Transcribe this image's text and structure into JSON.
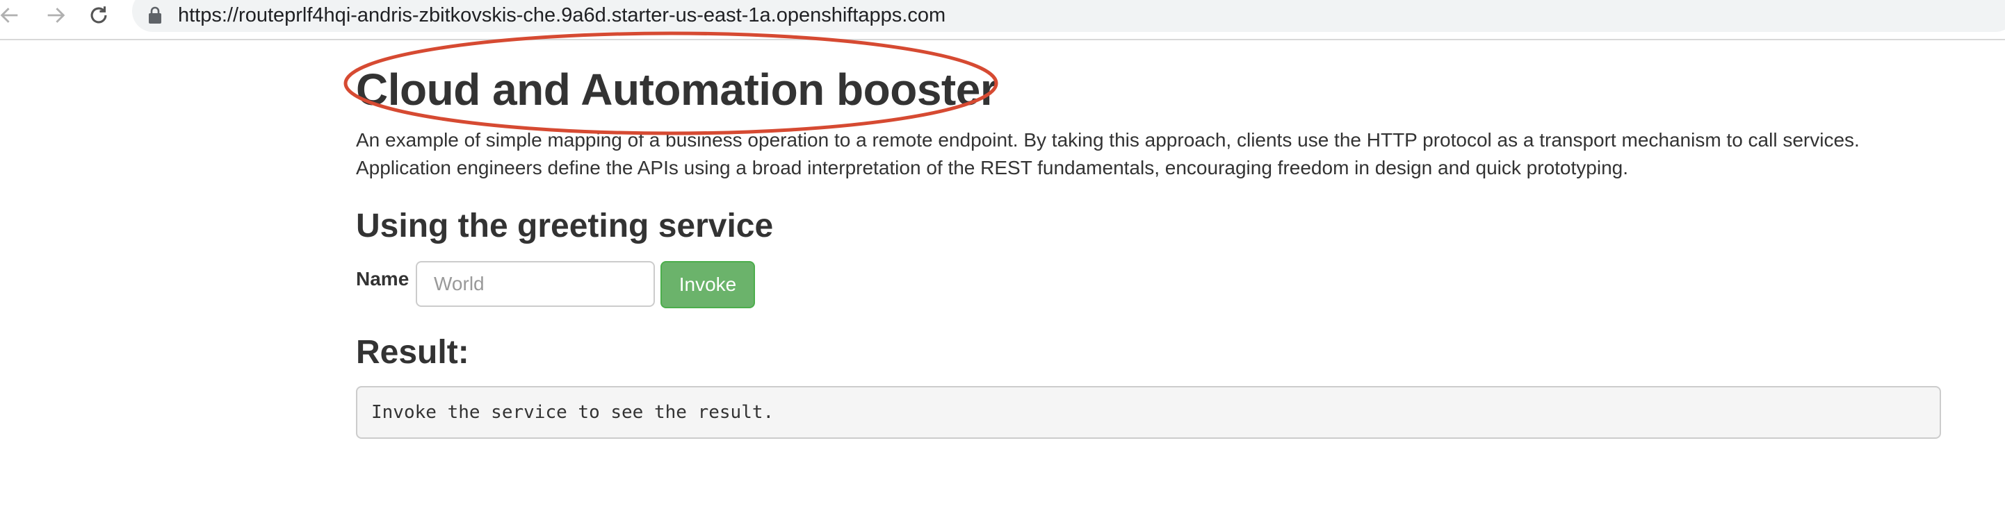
{
  "browser": {
    "url": "https://routeprlf4hqi-andris-zbitkovskis-che.9a6d.starter-us-east-1a.openshiftapps.com"
  },
  "page": {
    "title": "Cloud and Automation booster",
    "description": "An example of simple mapping of a business operation to a remote endpoint. By taking this approach, clients use the HTTP protocol as a transport mechanism to call services. Application engineers define the APIs using a broad interpretation of the REST fundamentals, encouraging freedom in design and quick prototyping.",
    "greeting_heading": "Using the greeting service",
    "name_label": "Name",
    "name_placeholder": "World",
    "name_value": "",
    "invoke_label": "Invoke",
    "result_heading": "Result:",
    "result_text": "Invoke the service to see the result."
  },
  "colors": {
    "invoke_button": "#6bb36b",
    "annotation_ellipse": "#d64a32",
    "text": "#333333"
  },
  "icons": {
    "back": "arrow-left-icon",
    "forward": "arrow-right-icon",
    "reload": "reload-icon",
    "lock": "lock-icon"
  }
}
